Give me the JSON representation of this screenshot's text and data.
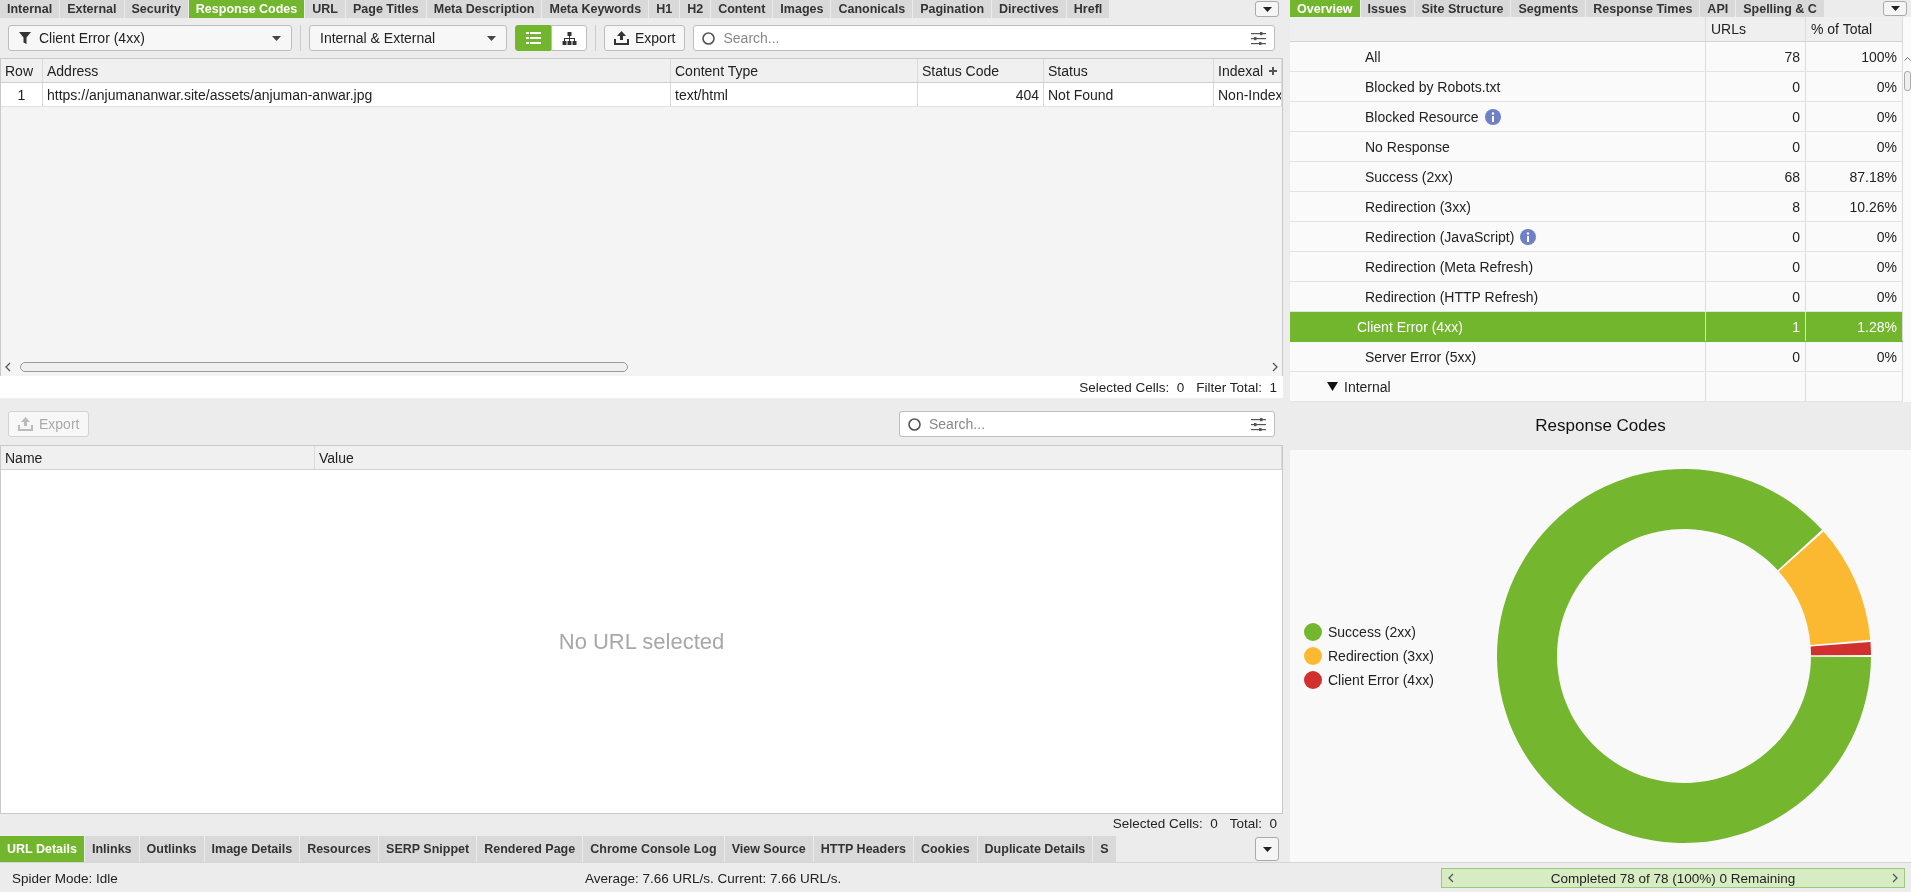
{
  "top_tabs": [
    {
      "label": "Internal",
      "selected": false
    },
    {
      "label": "External",
      "selected": false
    },
    {
      "label": "Security",
      "selected": false
    },
    {
      "label": "Response Codes",
      "selected": true
    },
    {
      "label": "URL",
      "selected": false
    },
    {
      "label": "Page Titles",
      "selected": false
    },
    {
      "label": "Meta Description",
      "selected": false
    },
    {
      "label": "Meta Keywords",
      "selected": false
    },
    {
      "label": "H1",
      "selected": false
    },
    {
      "label": "H2",
      "selected": false
    },
    {
      "label": "Content",
      "selected": false
    },
    {
      "label": "Images",
      "selected": false
    },
    {
      "label": "Canonicals",
      "selected": false
    },
    {
      "label": "Pagination",
      "selected": false
    },
    {
      "label": "Directives",
      "selected": false
    },
    {
      "label": "Hrefl",
      "selected": false
    }
  ],
  "toolbar": {
    "filter": "Client Error (4xx)",
    "scope": "Internal & External",
    "view_modes": [
      {
        "kind": "list",
        "selected": true
      },
      {
        "kind": "tree",
        "selected": false
      }
    ],
    "export": "Export",
    "search": {
      "placeholder": "Search..."
    }
  },
  "table": {
    "columns": [
      "Row",
      "Address",
      "Content Type",
      "Status Code",
      "Status",
      "Indexal"
    ],
    "rows": [
      [
        "1",
        "https://anjumananwar.site/assets/anjuman-anwar.jpg",
        "text/html",
        "404",
        "Not Found",
        "Non-Index"
      ]
    ],
    "footer": [
      "Selected Cells:  0",
      "Filter Total:  1"
    ]
  },
  "details": {
    "export": {
      "label": "Export",
      "disabled": true
    },
    "search": {
      "placeholder": "Search..."
    },
    "columns": [
      "Name",
      "Value"
    ],
    "empty_message": "No URL selected",
    "footer": [
      "Selected Cells:  0",
      "Total:  0"
    ]
  },
  "bottom_tabs": [
    {
      "label": "URL Details",
      "selected": true
    },
    {
      "label": "Inlinks",
      "selected": false
    },
    {
      "label": "Outlinks",
      "selected": false
    },
    {
      "label": "Image Details",
      "selected": false
    },
    {
      "label": "Resources",
      "selected": false
    },
    {
      "label": "SERP Snippet",
      "selected": false
    },
    {
      "label": "Rendered Page",
      "selected": false
    },
    {
      "label": "Chrome Console Log",
      "selected": false
    },
    {
      "label": "View Source",
      "selected": false
    },
    {
      "label": "HTTP Headers",
      "selected": false
    },
    {
      "label": "Cookies",
      "selected": false
    },
    {
      "label": "Duplicate Details",
      "selected": false
    },
    {
      "label": "S",
      "selected": false
    }
  ],
  "overview": {
    "tabs": [
      {
        "label": "Overview",
        "selected": true
      },
      {
        "label": "Issues",
        "selected": false
      },
      {
        "label": "Site Structure",
        "selected": false
      },
      {
        "label": "Segments",
        "selected": false
      },
      {
        "label": "Response Times",
        "selected": false
      },
      {
        "label": "API",
        "selected": false
      },
      {
        "label": "Spelling & C",
        "selected": false
      }
    ],
    "columns": [
      "URLs",
      "% of Total"
    ],
    "rows": [
      {
        "kind": "item",
        "label": "All",
        "urls": "78",
        "percent": "100%",
        "info": false,
        "selected": false
      },
      {
        "kind": "item",
        "label": "Blocked by Robots.txt",
        "urls": "0",
        "percent": "0%",
        "info": false,
        "selected": false
      },
      {
        "kind": "item",
        "label": "Blocked Resource",
        "urls": "0",
        "percent": "0%",
        "info": true,
        "selected": false
      },
      {
        "kind": "item",
        "label": "No Response",
        "urls": "0",
        "percent": "0%",
        "info": false,
        "selected": false
      },
      {
        "kind": "item",
        "label": "Success (2xx)",
        "urls": "68",
        "percent": "87.18%",
        "info": false,
        "selected": false
      },
      {
        "kind": "item",
        "label": "Redirection (3xx)",
        "urls": "8",
        "percent": "10.26%",
        "info": false,
        "selected": false
      },
      {
        "kind": "item",
        "label": "Redirection (JavaScript)",
        "urls": "0",
        "percent": "0%",
        "info": true,
        "selected": false
      },
      {
        "kind": "item",
        "label": "Redirection (Meta Refresh)",
        "urls": "0",
        "percent": "0%",
        "info": false,
        "selected": false
      },
      {
        "kind": "item",
        "label": "Redirection (HTTP Refresh)",
        "urls": "0",
        "percent": "0%",
        "info": false,
        "selected": false
      },
      {
        "kind": "item",
        "label": "Client Error (4xx)",
        "urls": "1",
        "percent": "1.28%",
        "info": false,
        "selected": true
      },
      {
        "kind": "item",
        "label": "Server Error (5xx)",
        "urls": "0",
        "percent": "0%",
        "info": false,
        "selected": false
      },
      {
        "kind": "group",
        "label": "Internal",
        "expanded": true,
        "selected": false
      }
    ]
  },
  "chart": {
    "title": "Response Codes",
    "legend": [
      {
        "color": "#74b62e"
      },
      {
        "color": "#fbb931"
      },
      {
        "color": "#d1302f"
      }
    ],
    "chart_data": {
      "type": "donut",
      "categories": [
        "Success (2xx)",
        "Redirection (3xx)",
        "Client Error (4xx)"
      ],
      "series": [
        {
          "values": [
            87.18,
            10.26,
            1.28
          ]
        }
      ]
    }
  },
  "status_bar": {
    "mode": "Spider Mode: Idle",
    "speed": "Average: 7.66 URL/s. Current: 7.66 URL/s.",
    "progress": "Completed 78 of 78 (100%) 0 Remaining"
  }
}
